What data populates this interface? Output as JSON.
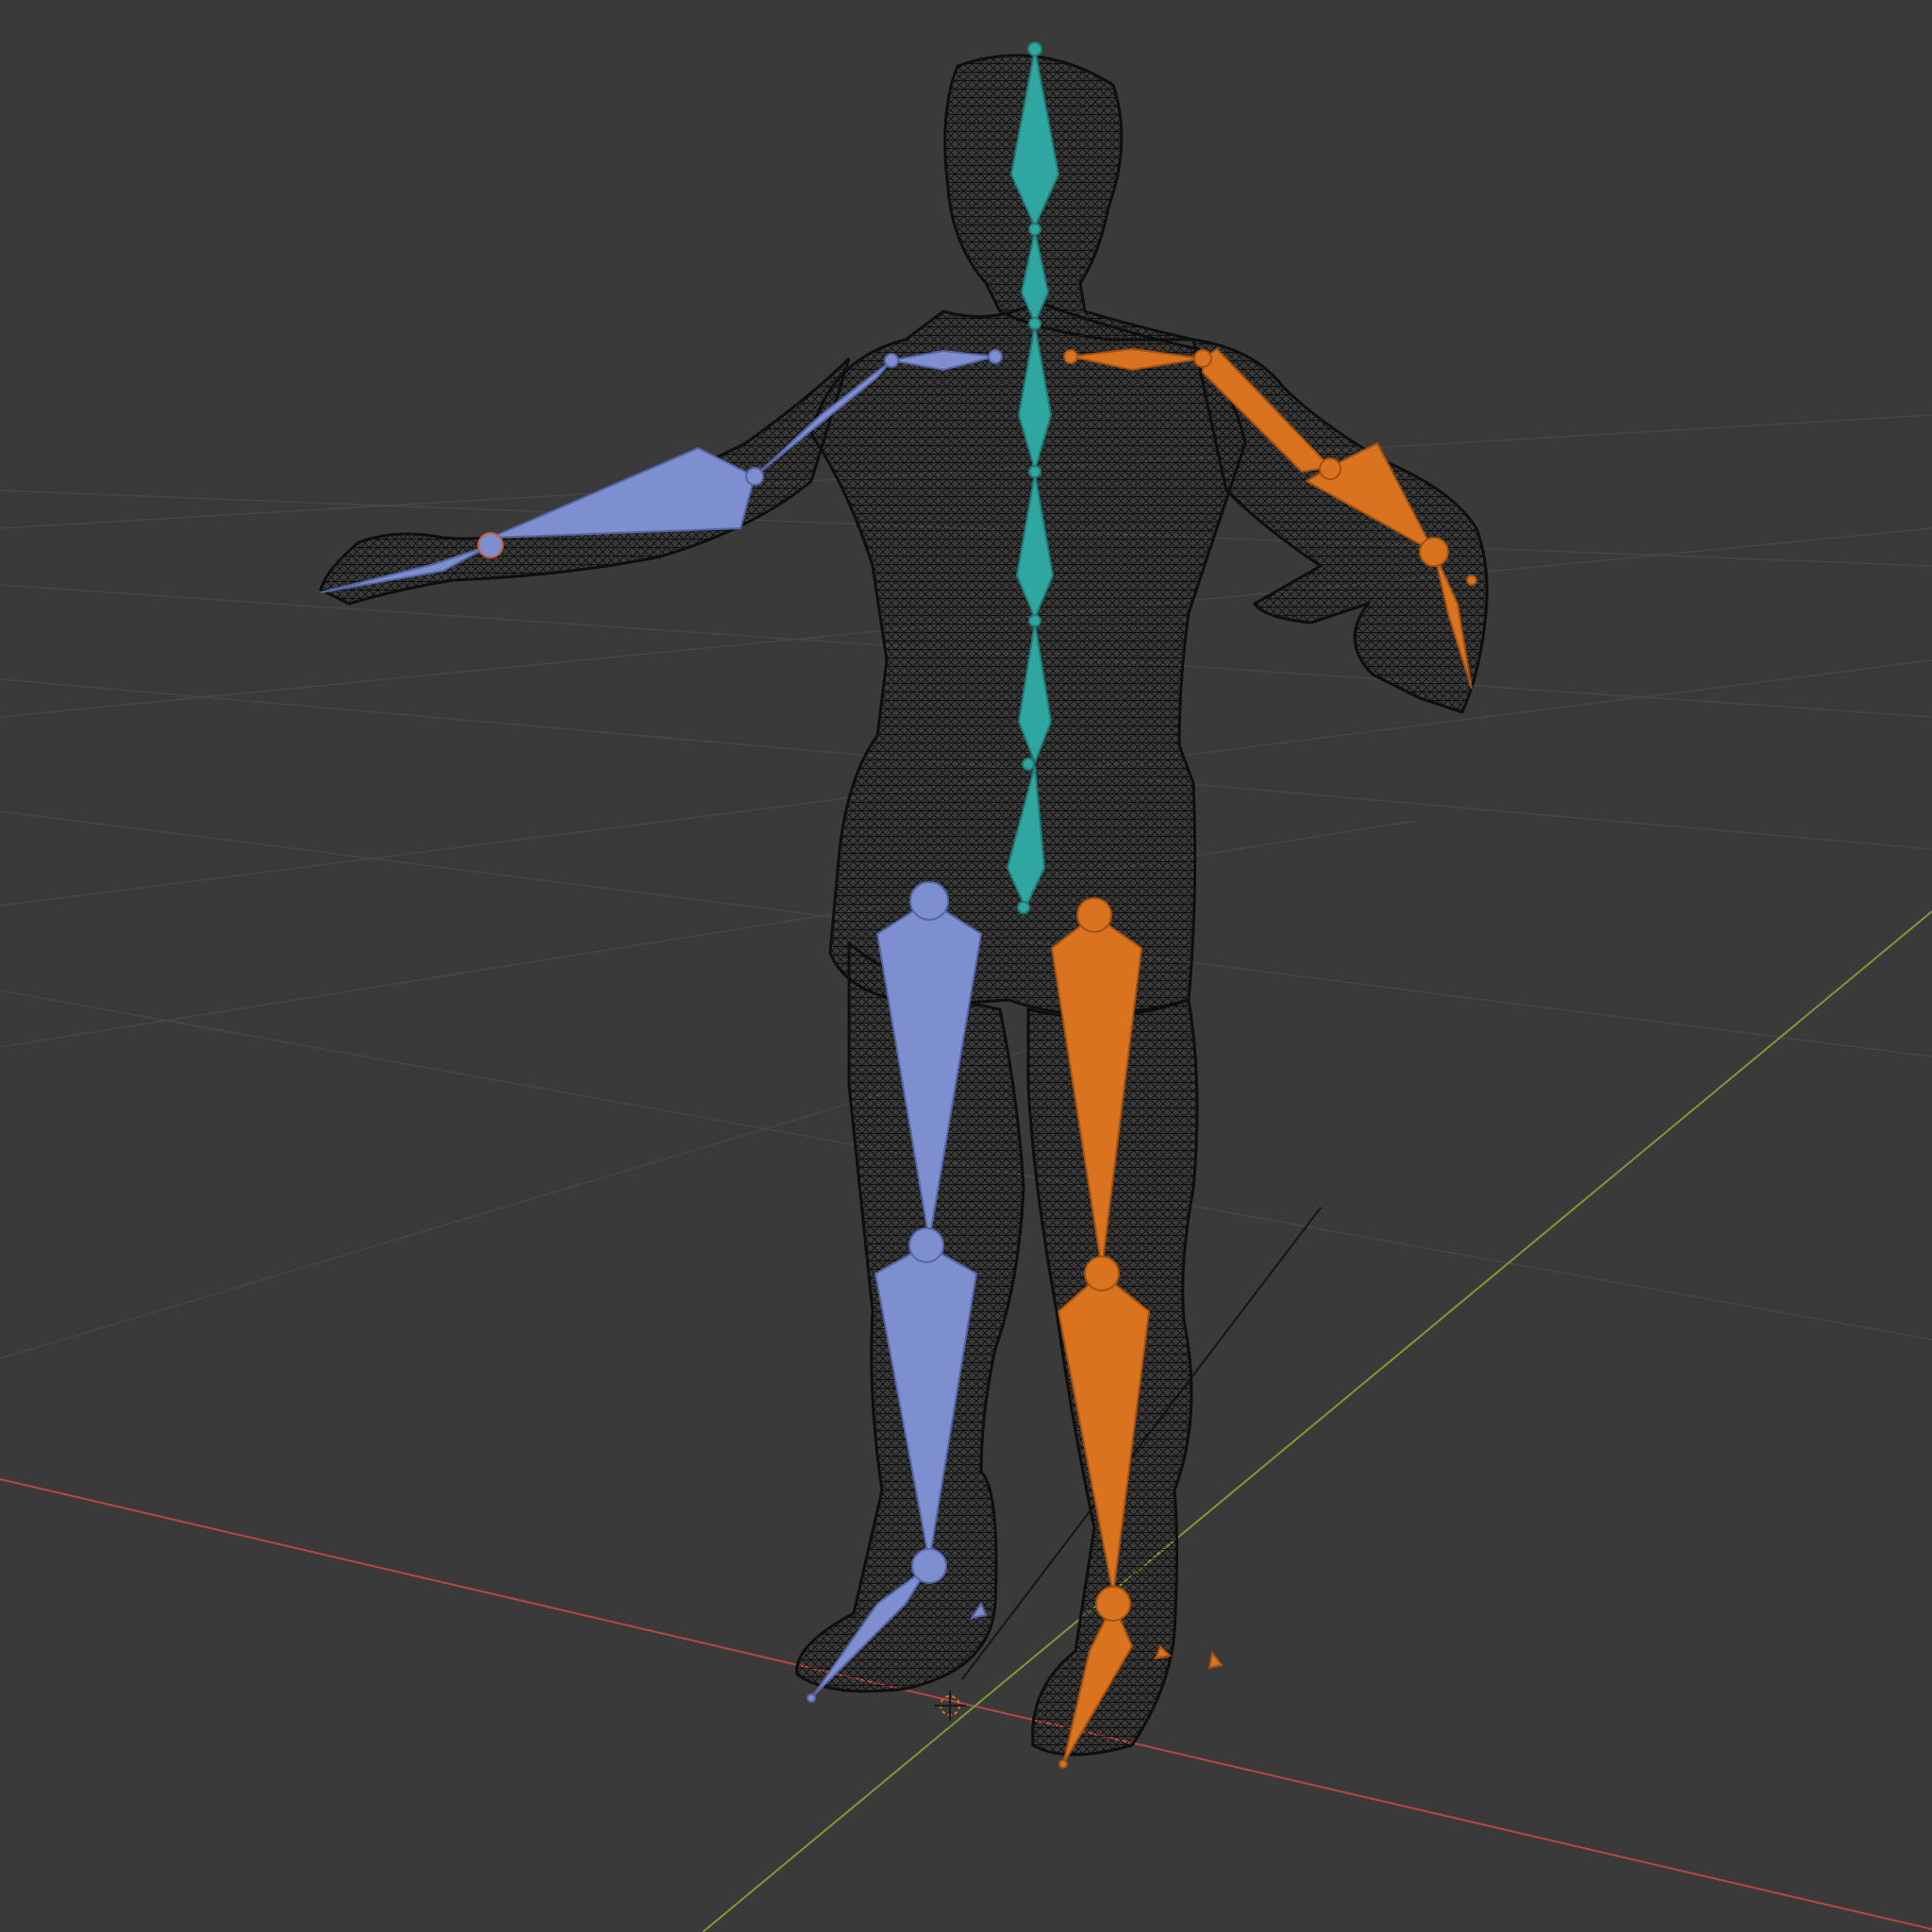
{
  "viewport": {
    "shading": "wireframe",
    "background": "#3a3a3a",
    "grid_color": "#474747",
    "axis_x_color": "#b84646",
    "axis_y_color": "#7c9a2f",
    "mesh_color": "#0c0c0c"
  },
  "armature": {
    "colors": {
      "center": "#2fa6a0",
      "left": "#7d8fcf",
      "right": "#d9731f"
    },
    "bone_groups": [
      "center",
      "left",
      "right"
    ]
  },
  "mesh": {
    "name_icon": "human-figure-mesh"
  },
  "cursor": {
    "icon": "3d-cursor-icon"
  }
}
